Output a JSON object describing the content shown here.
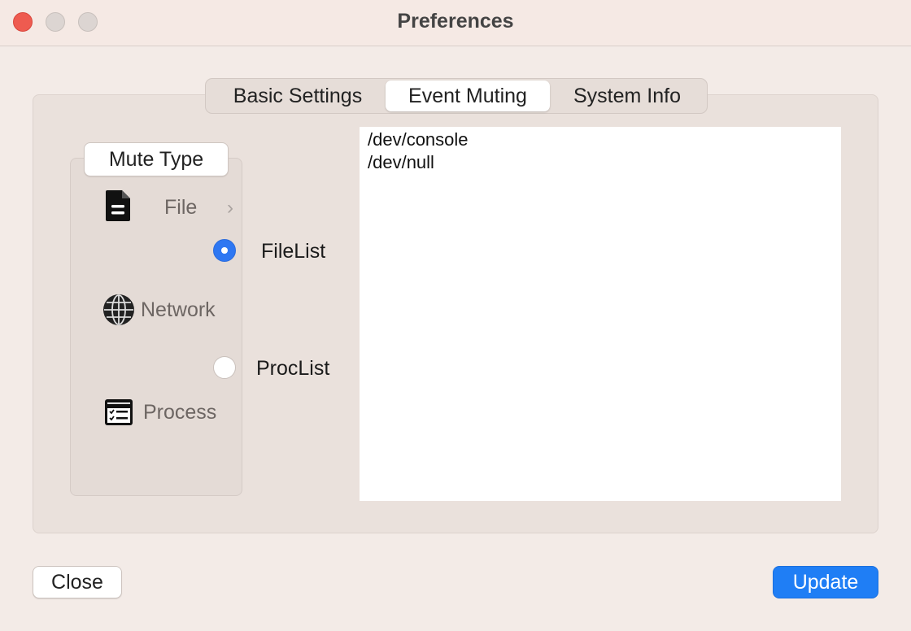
{
  "window": {
    "title": "Preferences"
  },
  "tabs": [
    {
      "label": "Basic Settings",
      "active": false
    },
    {
      "label": "Event Muting",
      "active": true
    },
    {
      "label": "System Info",
      "active": false
    }
  ],
  "mute_type": {
    "label": "Mute Type",
    "items": [
      {
        "label": "File",
        "icon": "document-icon"
      },
      {
        "label": "Network",
        "icon": "globe-icon"
      },
      {
        "label": "Process",
        "icon": "process-window-icon"
      }
    ]
  },
  "lists": [
    {
      "label": "FileList",
      "selected": true
    },
    {
      "label": "ProcList",
      "selected": false
    }
  ],
  "entries": [
    "/dev/console",
    "/dev/null"
  ],
  "buttons": {
    "close": "Close",
    "update": "Update"
  },
  "colors": {
    "accent": "#1f7ef5",
    "close_light": "#ee5b50"
  }
}
